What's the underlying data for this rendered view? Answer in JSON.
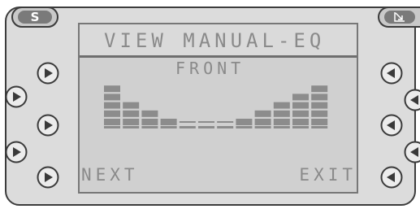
{
  "device": {
    "s_button_label": "S",
    "corner_icon": "corner-arrow-icon",
    "left_buttons": [
      "play-right-icon",
      "play-right-icon",
      "play-right-icon",
      "play-right-icon",
      "play-right-icon",
      "play-right-icon"
    ],
    "right_buttons": [
      "play-left-icon",
      "play-left-icon",
      "play-left-icon",
      "play-left-icon",
      "play-left-icon",
      "play-left-icon"
    ]
  },
  "screen": {
    "title": "VIEW MANUAL-EQ",
    "subtitle": "FRONT",
    "softkey_left": "NEXT",
    "softkey_right": "EXIT"
  },
  "chart_data": {
    "type": "bar",
    "categories": [
      "",
      "",
      "",
      "",
      "",
      "",
      "",
      "",
      "",
      "",
      "",
      ""
    ],
    "values": [
      5,
      3,
      2,
      1,
      0,
      0,
      0,
      1,
      2,
      3,
      4,
      5
    ],
    "ylim": [
      0,
      5
    ]
  },
  "colors": {
    "lcd_bg": "#d0d0d0",
    "lcd_text": "#8a8a8a",
    "device_bg": "#dcdcdc"
  }
}
